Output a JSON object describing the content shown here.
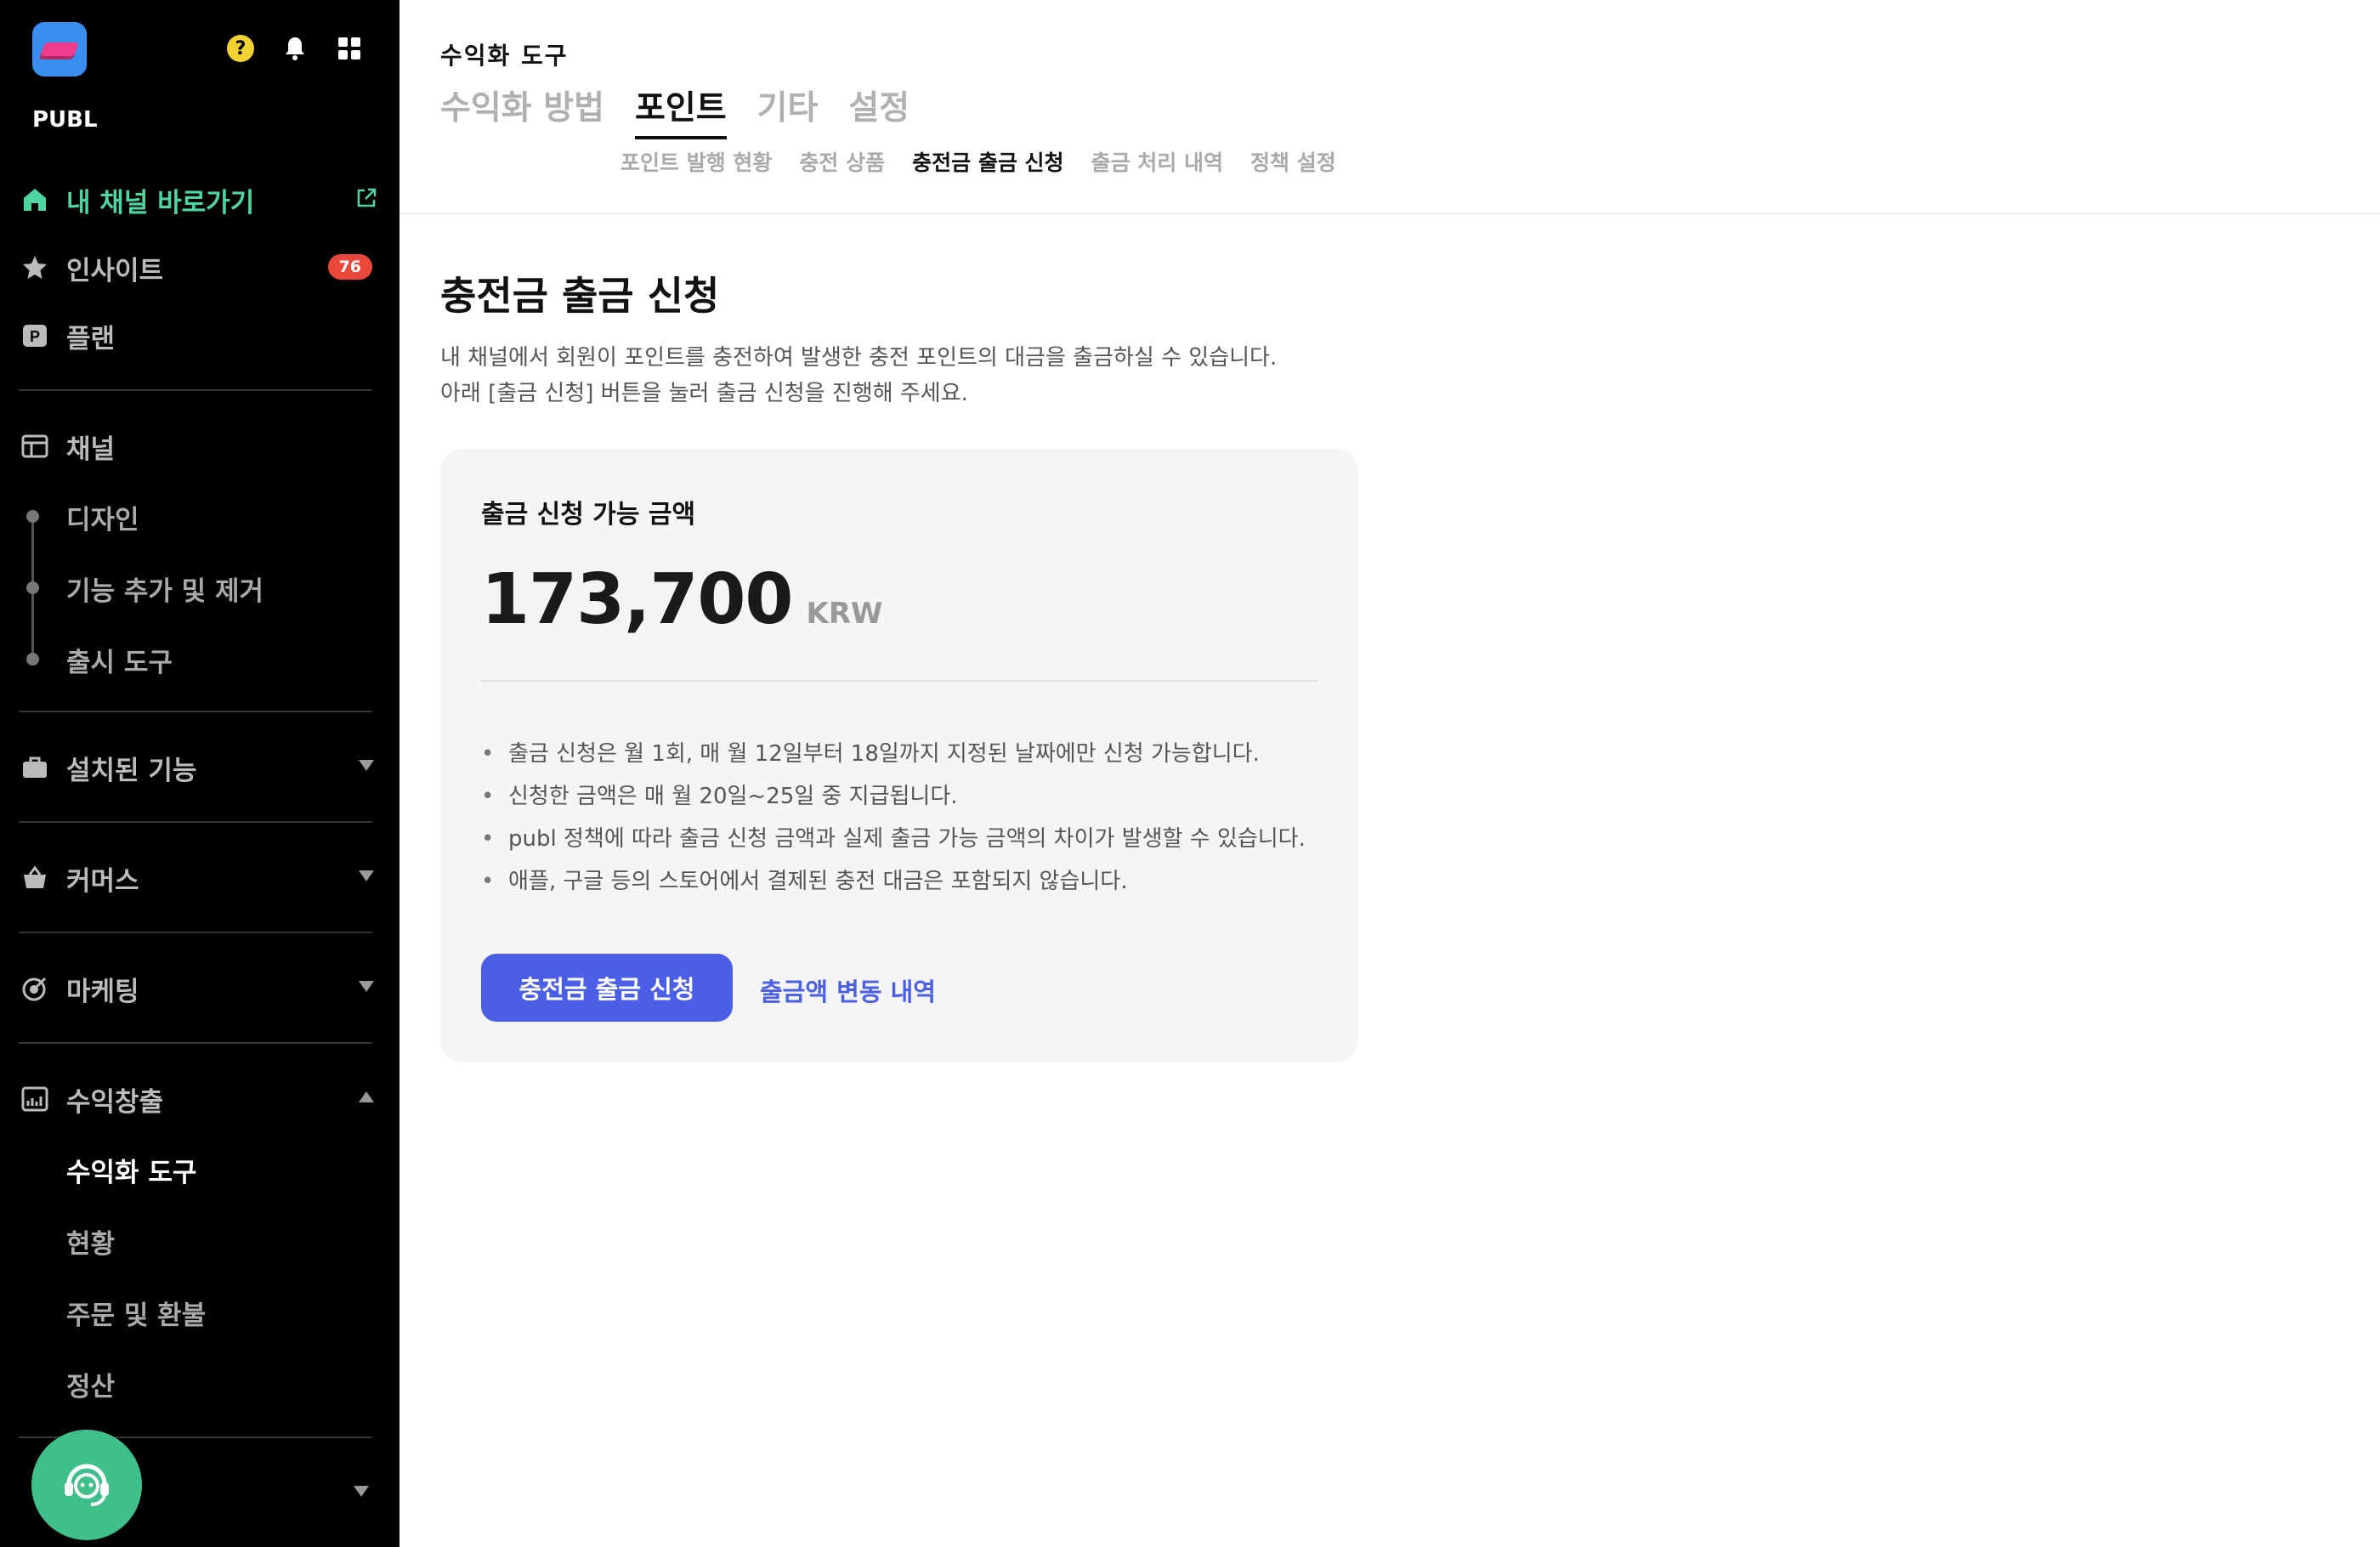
{
  "app": {
    "brand": "PUBL"
  },
  "sidebar": {
    "home": {
      "label": "내 채널 바로가기"
    },
    "insight": {
      "label": "인사이트",
      "badge": "76"
    },
    "plan": {
      "label": "플랜"
    },
    "channel": {
      "label": "채널",
      "children": [
        "디자인",
        "기능 추가 및 제거",
        "출시 도구"
      ]
    },
    "installed": {
      "label": "설치된 기능"
    },
    "commerce": {
      "label": "커머스"
    },
    "marketing": {
      "label": "마케팅"
    },
    "revenue": {
      "label": "수익창출",
      "children": [
        "수익화 도구",
        "현황",
        "주문 및 환불",
        "정산"
      ],
      "active_child": "수익화 도구"
    }
  },
  "header": {
    "breadcrumb": "수익화 도구",
    "tabs": [
      "수익화 방법",
      "포인트",
      "기타",
      "설정"
    ],
    "active_tab": "포인트",
    "subtabs": [
      "포인트 발행 현황",
      "충전 상품",
      "충전금 출금 신청",
      "출금 처리 내역",
      "정책 설정"
    ],
    "active_subtab": "충전금 출금 신청"
  },
  "content": {
    "title": "충전금 출금 신청",
    "description": [
      "내 채널에서 회원이 포인트를 충전하여 발생한 충전 포인트의 대금을 출금하실 수 있습니다.",
      "아래 [출금 신청] 버튼을 눌러 출금 신청을 진행해 주세요."
    ],
    "card": {
      "label": "출금 신청 가능 금액",
      "amount": "173,700",
      "currency": "KRW",
      "notes": [
        "출금 신청은 월 1회, 매 월 12일부터 18일까지 지정된 날짜에만 신청 가능합니다.",
        "신청한 금액은 매 월 20일~25일 중 지급됩니다.",
        "publ 정책에 따라 출금 신청 금액과 실제 출금 가능 금액의 차이가 발생할 수 있습니다.",
        "애플, 구글 등의 스토어에서 결제된 충전 대금은 포함되지 않습니다."
      ],
      "primary_button": "충전금 출금 신청",
      "link_button": "출금액 변동 내역"
    }
  },
  "colors": {
    "sidebar_bg": "#000000",
    "home_accent": "#4fd6a0",
    "badge": "#e8473a",
    "primary": "#4a5ee6",
    "card_bg": "#f5f5f6"
  },
  "icons": {
    "help": "question-icon",
    "notifications": "bell-icon",
    "apps": "grid-icon",
    "home": "home-icon",
    "insight": "star-icon",
    "plan": "p-badge-icon",
    "channel": "layout-icon",
    "installed": "briefcase-icon",
    "commerce": "basket-icon",
    "marketing": "target-icon",
    "revenue": "chart-icon",
    "support": "headset-icon"
  }
}
